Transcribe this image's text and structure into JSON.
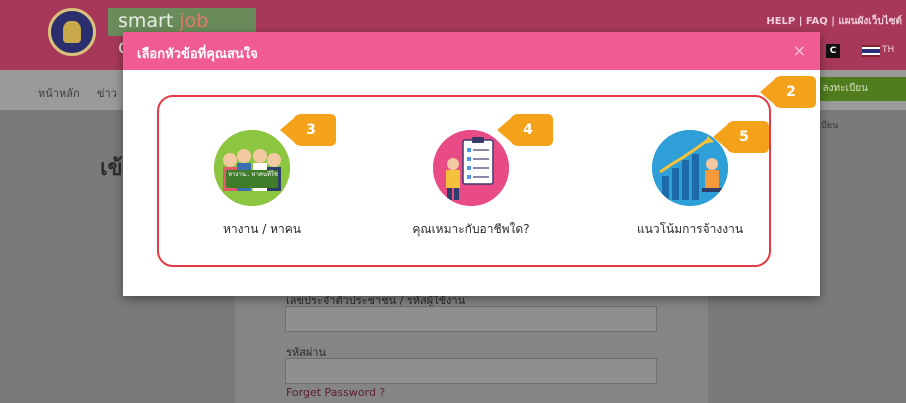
{
  "header": {
    "brand_smart": "smart",
    "brand_job": "job",
    "brand_center": "center",
    "top_links": "HELP | FAQ | แผนผังเว็บไซต์",
    "contrast_label": "C",
    "language": "TH"
  },
  "nav": {
    "home": "หน้าหลัก",
    "news": "ข่าว",
    "register": "/ ลงทะเบียน"
  },
  "side_note": "เบียน",
  "login": {
    "title": "เข้",
    "id_label": "เลขประจำตัวประชาชน / รหัสผู้ใช้งาน",
    "password_label": "รหัสผ่าน",
    "forget": "Forget Password ?"
  },
  "modal": {
    "title": "เลือกหัวข้อที่คุณสนใจ",
    "close": "×",
    "hire_banner": "หางาน.. หาคนที่ใช่",
    "options": [
      {
        "label": "หางาน / หาคน",
        "icon": "job-people-icon"
      },
      {
        "label": "คุณเหมาะกับอาชีพใด?",
        "icon": "checklist-icon"
      },
      {
        "label": "แนวโน้มการจ้างงาน",
        "icon": "trend-chart-icon"
      }
    ]
  },
  "callouts": [
    "2",
    "3",
    "4",
    "5"
  ],
  "colors": {
    "modal_header": "#ef5b92",
    "outline": "#e33b46",
    "callout": "#f3a21a",
    "circle_green": "#8cc53f",
    "circle_pink": "#e94b86",
    "circle_blue": "#2f9fd8"
  }
}
